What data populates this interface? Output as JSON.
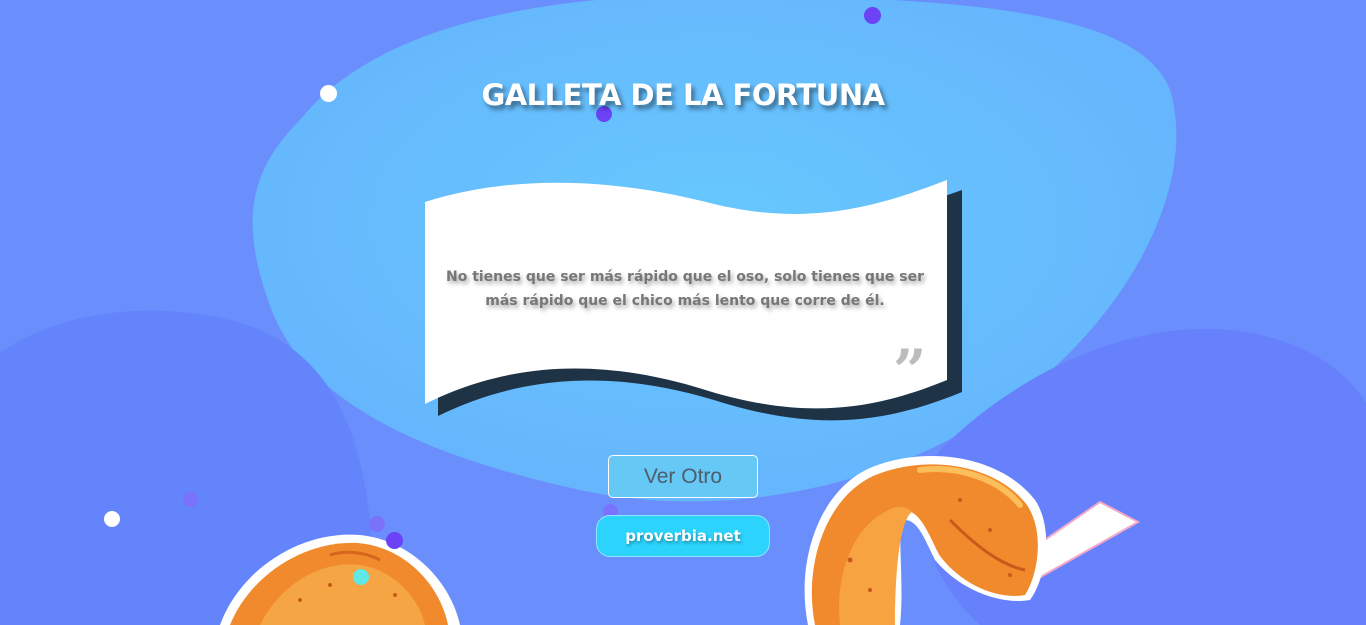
{
  "header": {
    "title": "GALLETA DE LA FORTUNA"
  },
  "fortune": {
    "quote": "No tienes que ser más rápido que el oso, solo tienes que ser más rápido que el chico más lento que corre de él.",
    "quote_mark": "”"
  },
  "buttons": {
    "next_label": "Ver Otro",
    "site_label": "proverbia.net"
  },
  "colors": {
    "background": "#6a90fd",
    "blob_light": "#67c4fd",
    "button_accent": "#2cd4fd",
    "card_shadow": "#1f3346",
    "cookie_orange": "#f08a2c"
  },
  "icons": {
    "quote": "closing-quote-icon",
    "cookies": "fortune-cookie-icon"
  }
}
